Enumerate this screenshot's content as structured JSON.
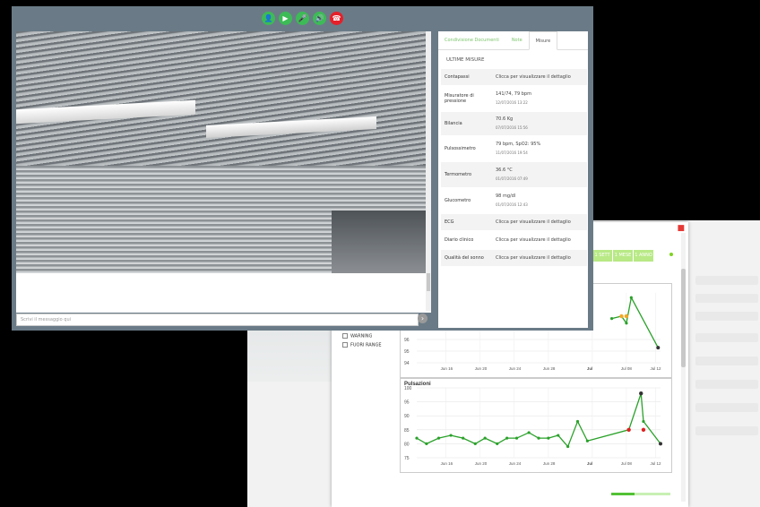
{
  "controls": [
    {
      "icon": "user-icon",
      "glyph": "👤"
    },
    {
      "icon": "video-icon",
      "glyph": "▶"
    },
    {
      "icon": "microphone-icon",
      "glyph": "🎤"
    },
    {
      "icon": "speaker-icon",
      "glyph": "🔊"
    },
    {
      "icon": "hangup-icon",
      "glyph": "☎"
    }
  ],
  "chat": {
    "placeholder": "Scrivi il messaggio qui"
  },
  "panel": {
    "tabs": [
      {
        "label": "Condivisione Documenti"
      },
      {
        "label": "Note"
      },
      {
        "label": "Misure"
      }
    ],
    "title": "ULTIME MISURE",
    "rows": [
      {
        "label": "Contapassi",
        "value": "Clicca per visualizzare il dettaglio",
        "time": ""
      },
      {
        "label": "Misuratore di pressione",
        "value": "141/74, 79 bpm",
        "time": "12/07/2016 13:22"
      },
      {
        "label": "Bilancia",
        "value": "70.6 Kg",
        "time": "07/07/2016 15:56"
      },
      {
        "label": "Pulsossimetro",
        "value": "79 bpm, SpO2: 95%",
        "time": "11/07/2016 19:54"
      },
      {
        "label": "Termometro",
        "value": "36.6 °C",
        "time": "01/07/2016 07:49"
      },
      {
        "label": "Glucometro",
        "value": "98 mg/dl",
        "time": "01/07/2016 12:43"
      },
      {
        "label": "ECG",
        "value": "Clicca per visualizzare il dettaglio",
        "time": ""
      },
      {
        "label": "Diario clinico",
        "value": "Clicca per visualizzare il dettaglio",
        "time": ""
      },
      {
        "label": "Qualità del sonno",
        "value": "Clicca per visualizzare il dettaglio",
        "time": ""
      }
    ]
  },
  "legend": {
    "items": [
      {
        "label": "WARNING"
      },
      {
        "label": "FUORI RANGE"
      }
    ]
  },
  "range_buttons": [
    {
      "label": "1 SETT"
    },
    {
      "label": "1 MESE"
    },
    {
      "label": "1 ANNO"
    }
  ],
  "colors": {
    "accent": "#7cc56b",
    "line": "#2aa12a",
    "warning": "#f5a623",
    "alarm": "#e02020"
  },
  "chart_data": [
    {
      "type": "line",
      "title": "",
      "x": [
        "Jun 16",
        "Jun 20",
        "Jun 24",
        "Jun 28",
        "Jul",
        "Jul 08",
        "Jul 12"
      ],
      "ylim": [
        94,
        100
      ],
      "yticks": [
        94,
        95,
        96
      ],
      "series": [
        {
          "values": [
            [
              0.8,
              97.8
            ],
            [
              0.84,
              98.0
            ],
            [
              0.86,
              97.4
            ],
            [
              0.88,
              99.6
            ],
            [
              0.99,
              95.3
            ]
          ]
        }
      ],
      "markers": [
        {
          "x": 0.84,
          "y": 98.0,
          "status": "warning"
        },
        {
          "x": 0.86,
          "y": 98.0,
          "status": "warning"
        }
      ]
    },
    {
      "type": "line",
      "title": "Pulsazioni",
      "x": [
        "Jun 16",
        "Jun 20",
        "Jun 24",
        "Jun 28",
        "Jul",
        "Jul 08",
        "Jul 12"
      ],
      "ylim": [
        75,
        100
      ],
      "yticks": [
        75,
        80,
        85,
        90,
        95,
        100
      ],
      "series": [
        {
          "values": [
            [
              0.0,
              82
            ],
            [
              0.04,
              80
            ],
            [
              0.09,
              82
            ],
            [
              0.14,
              83
            ],
            [
              0.19,
              82
            ],
            [
              0.24,
              80
            ],
            [
              0.28,
              82
            ],
            [
              0.33,
              80
            ],
            [
              0.37,
              82
            ],
            [
              0.41,
              82
            ],
            [
              0.46,
              84
            ],
            [
              0.5,
              82
            ],
            [
              0.54,
              82
            ],
            [
              0.58,
              83
            ],
            [
              0.62,
              79
            ],
            [
              0.66,
              88
            ],
            [
              0.7,
              81
            ],
            [
              0.87,
              85
            ],
            [
              0.92,
              98
            ],
            [
              0.93,
              88
            ],
            [
              1.0,
              80
            ]
          ]
        }
      ],
      "markers": [
        {
          "x": 0.87,
          "y": 85,
          "status": "alarm"
        },
        {
          "x": 0.93,
          "y": 85,
          "status": "alarm"
        },
        {
          "x": 0.92,
          "y": 98,
          "status": "normal"
        }
      ]
    }
  ]
}
